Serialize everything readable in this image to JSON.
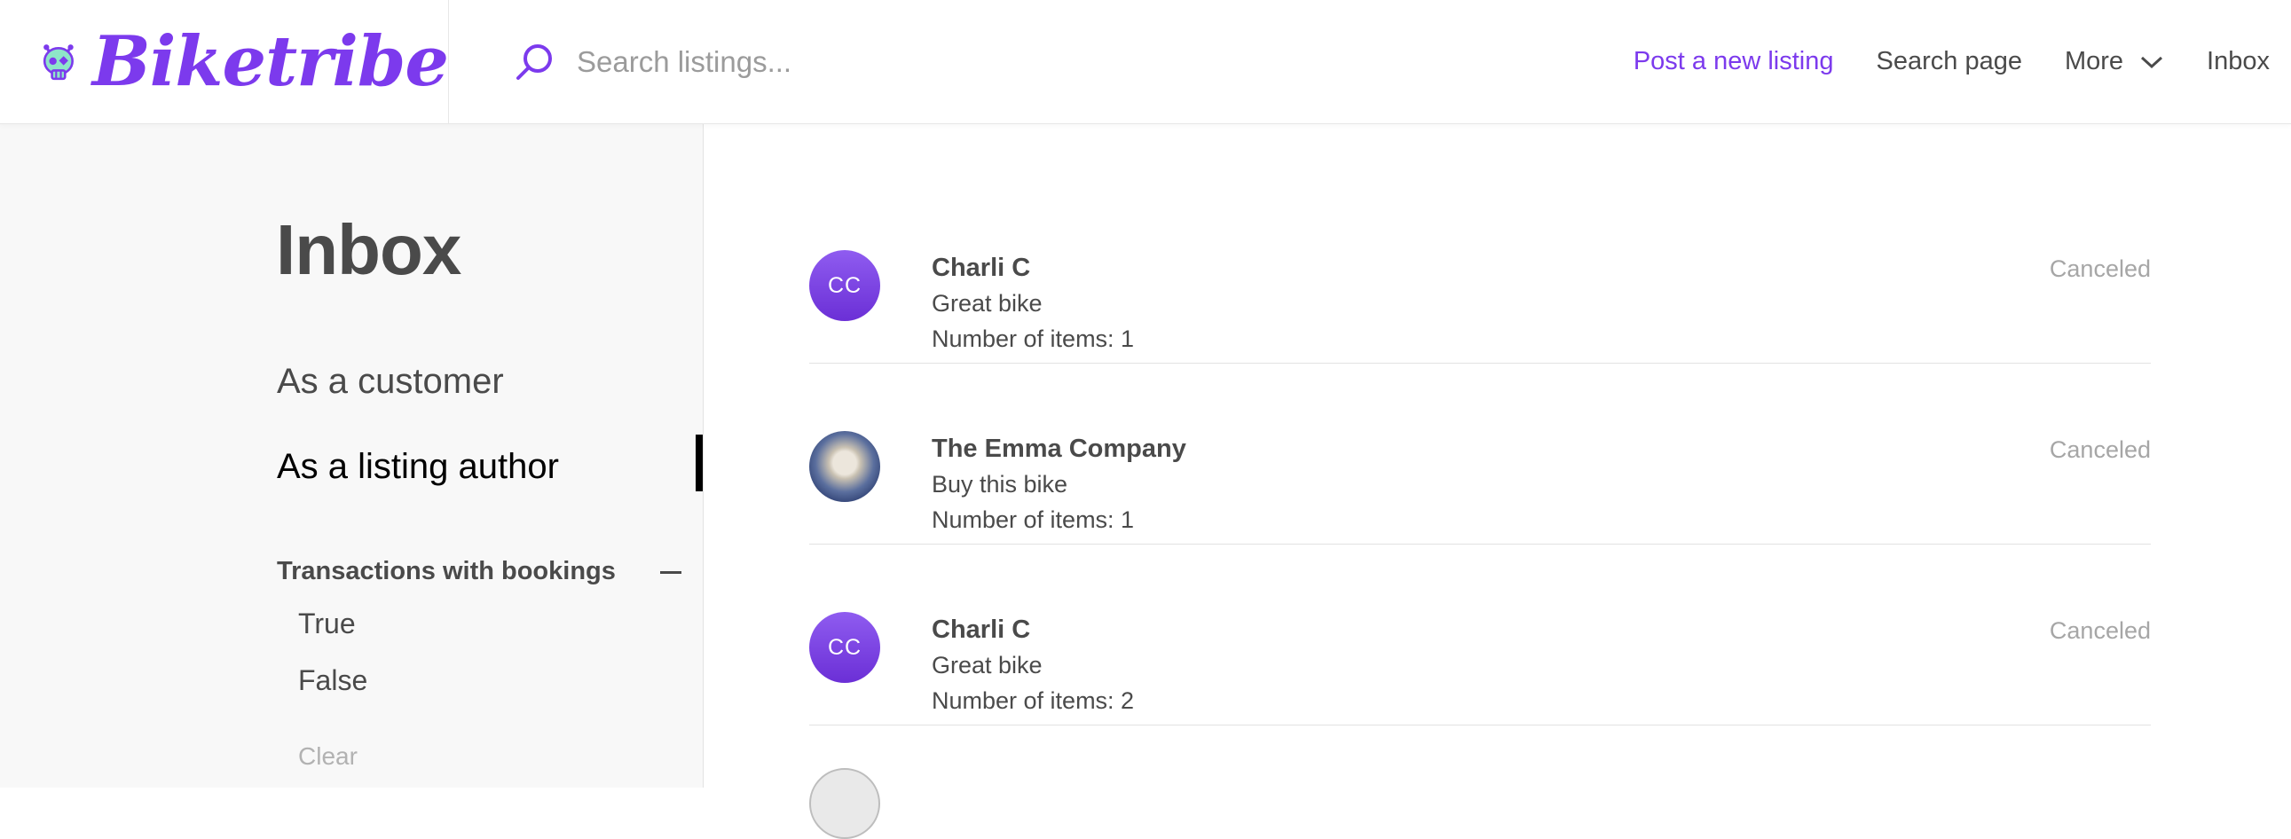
{
  "brand": {
    "name": "Biketribe",
    "accent_color": "#7c3aed",
    "logo_icon": "skull-logo-icon"
  },
  "search": {
    "placeholder": "Search listings...",
    "value": "",
    "icon": "search-icon"
  },
  "nav": {
    "post_listing": "Post a new listing",
    "search_page": "Search page",
    "more": "More",
    "inbox": "Inbox"
  },
  "sidebar": {
    "title": "Inbox",
    "tabs": [
      {
        "label": "As a customer",
        "selected": false
      },
      {
        "label": "As a listing author",
        "selected": true
      }
    ],
    "filter": {
      "heading": "Transactions with bookings",
      "options": [
        "True",
        "False"
      ],
      "clear": "Clear"
    }
  },
  "transactions": [
    {
      "avatar_initials": "CC",
      "name": "Charli C",
      "listing": "Great bike",
      "items": "Number of items: 1",
      "status": "Canceled"
    },
    {
      "avatar_initials": "",
      "avatar_type": "photo",
      "name": "The Emma Company",
      "listing": "Buy this bike",
      "items": "Number of items: 1",
      "status": "Canceled"
    },
    {
      "avatar_initials": "CC",
      "name": "Charli C",
      "listing": "Great bike",
      "items": "Number of items: 2",
      "status": "Canceled"
    }
  ]
}
